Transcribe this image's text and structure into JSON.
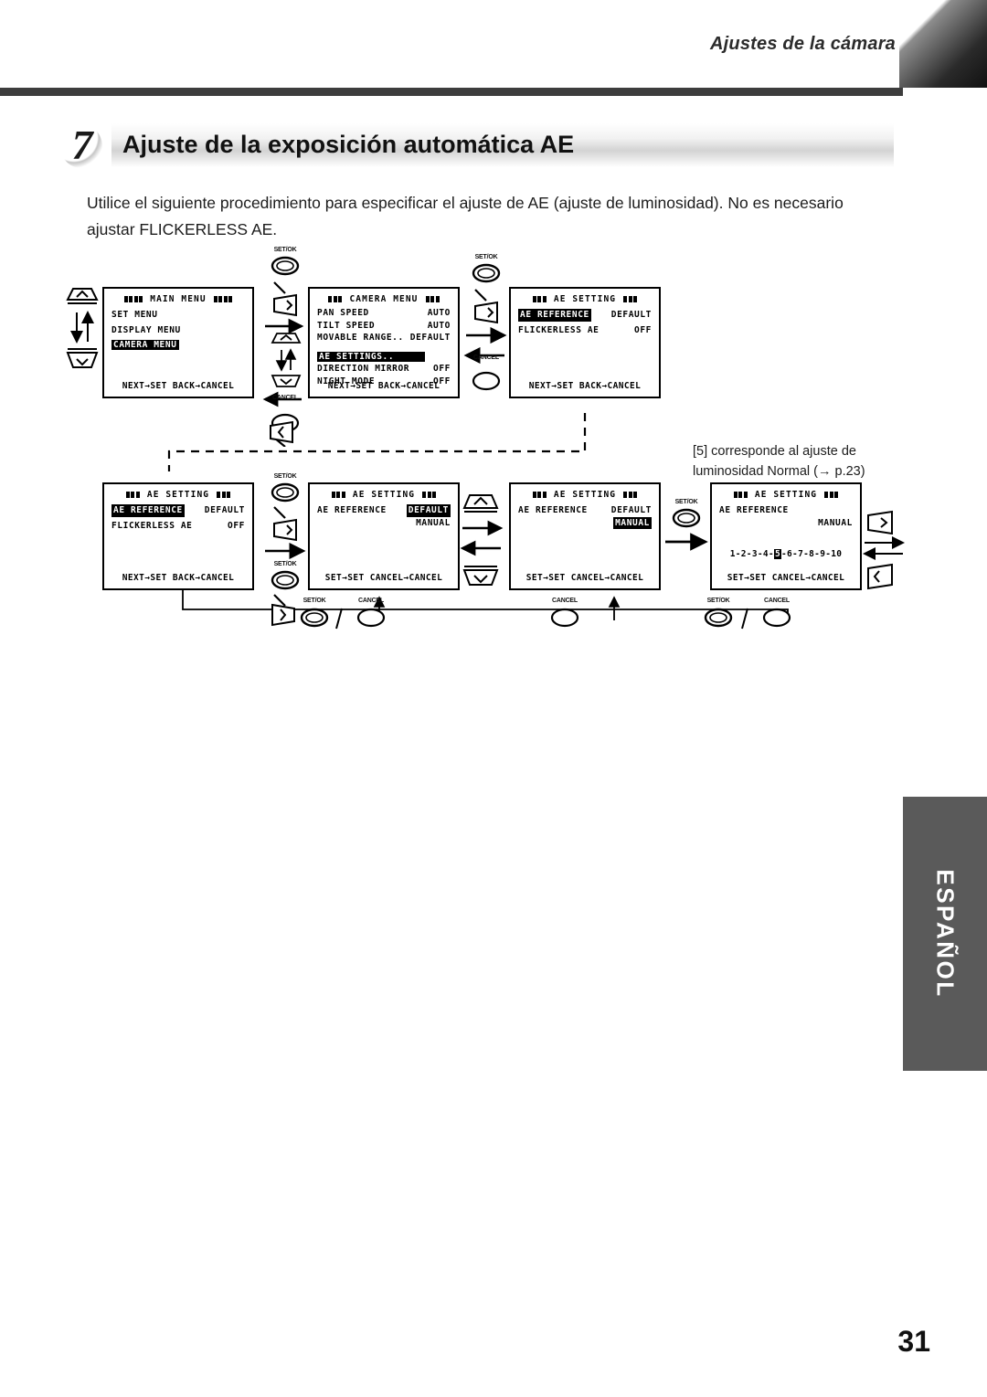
{
  "header": {
    "running_title": "Ajustes de la cámara"
  },
  "section": {
    "number": "7",
    "title": "Ajuste de la exposición automática AE"
  },
  "intro": "Utilice el siguiente procedimiento para especificar el ajuste de AE (ajuste de luminosidad). No es necesario ajustar FLICKERLESS AE.",
  "note": "[5] corresponde al ajuste de luminosidad Normal (→ p.23)",
  "footer": {
    "language_tab": "ESPAÑOL",
    "page_number": "31"
  },
  "buttons": {
    "set_ok": "SET/OK",
    "cancel": "CANCEL",
    "up": "up-arrow",
    "down": "down-arrow",
    "left": "left-arrow",
    "right": "right-arrow",
    "separator": "/"
  },
  "screens": [
    {
      "id": "main-menu",
      "title": "MAIN  MENU",
      "marker_blocks": 4,
      "rows": [
        {
          "label": "SET MENU",
          "value": "",
          "highlight": false
        },
        {
          "label": "DISPLAY MENU",
          "value": "",
          "highlight": false
        },
        {
          "label": "CAMERA MENU",
          "value": "",
          "highlight": true
        }
      ],
      "footer": "NEXT→SET  BACK→CANCEL"
    },
    {
      "id": "camera-menu",
      "title": "CAMERA MENU",
      "marker_blocks": 3,
      "rows": [
        {
          "label": "PAN  SPEED",
          "value": "AUTO",
          "highlight": false
        },
        {
          "label": "TILT SPEED",
          "value": "AUTO",
          "highlight": false
        },
        {
          "label": "MOVABLE RANGE..",
          "value": "DEFAULT",
          "highlight": false
        },
        {
          "label": "",
          "value": "",
          "highlight": false
        },
        {
          "label": "AE SETTINGS..",
          "value": "",
          "highlight": true
        },
        {
          "label": "DIRECTION MIRROR",
          "value": "OFF",
          "highlight": false
        },
        {
          "label": "NIGHT MODE",
          "value": "OFF",
          "highlight": false
        }
      ],
      "footer": "NEXT→SET  BACK→CANCEL"
    },
    {
      "id": "ae-setting-1",
      "title": "AE SETTING",
      "marker_blocks": 3,
      "rows": [
        {
          "label": "AE REFERENCE",
          "value": "DEFAULT",
          "highlight": true
        },
        {
          "label": "FLICKERLESS AE",
          "value": "OFF",
          "highlight": false
        }
      ],
      "footer": "NEXT→SET  BACK→CANCEL"
    },
    {
      "id": "ae-setting-2",
      "title": "AE SETTING",
      "marker_blocks": 3,
      "rows": [
        {
          "label": "AE REFERENCE",
          "value": "DEFAULT",
          "highlight": true
        },
        {
          "label": "FLICKERLESS AE",
          "value": "OFF",
          "highlight": false
        }
      ],
      "footer": "NEXT→SET  BACK→CANCEL"
    },
    {
      "id": "ae-reference-default",
      "title": "AE SETTING",
      "marker_blocks": 3,
      "label": "AE REFERENCE",
      "options": [
        {
          "text": "DEFAULT",
          "highlight": true
        },
        {
          "text": "MANUAL",
          "highlight": false
        }
      ],
      "footer": "SET→SET CANCEL→CANCEL"
    },
    {
      "id": "ae-reference-manual",
      "title": "AE SETTING",
      "marker_blocks": 3,
      "label": "AE REFERENCE",
      "options": [
        {
          "text": "DEFAULT",
          "highlight": false
        },
        {
          "text": "MANUAL",
          "highlight": true
        }
      ],
      "footer": "SET→SET CANCEL→CANCEL"
    },
    {
      "id": "ae-level-scale",
      "title": "AE SETTING",
      "marker_blocks": 3,
      "label": "AE REFERENCE",
      "value": "MANUAL",
      "scale": [
        "1",
        "2",
        "3",
        "4",
        "5",
        "6",
        "7",
        "8",
        "9",
        "10"
      ],
      "scale_selected": "5",
      "scale_separator": "-",
      "footer": "SET→SET CANCEL→CANCEL"
    }
  ]
}
